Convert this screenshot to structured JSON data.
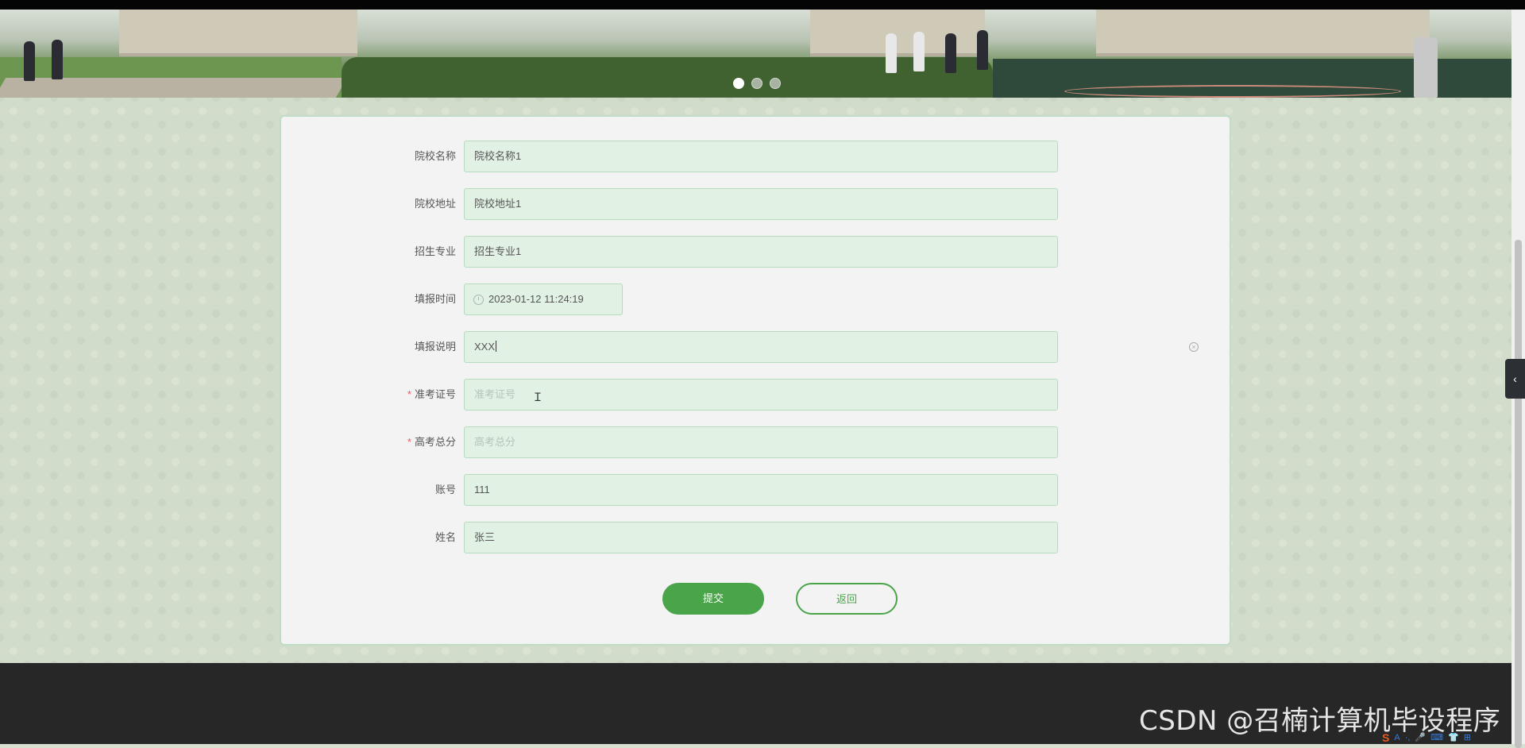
{
  "carousel": {
    "active_index": 0,
    "count": 3
  },
  "form": {
    "fields": [
      {
        "label": "院校名称",
        "value": "院校名称1",
        "required": false
      },
      {
        "label": "院校地址",
        "value": "院校地址1",
        "required": false
      },
      {
        "label": "招生专业",
        "value": "招生专业1",
        "required": false
      },
      {
        "label": "填报时间",
        "value": "2023-01-12 11:24:19",
        "required": false
      },
      {
        "label": "填报说明",
        "value": "XXX",
        "required": false
      },
      {
        "label": "准考证号",
        "placeholder": "准考证号",
        "required": true
      },
      {
        "label": "高考总分",
        "placeholder": "高考总分",
        "required": true
      },
      {
        "label": "账号",
        "value": "111",
        "required": false
      },
      {
        "label": "姓名",
        "value": "张三",
        "required": false
      }
    ],
    "required_mark": "*",
    "submit_label": "提交",
    "back_label": "返回"
  },
  "watermark": "CSDN @召楠计算机毕设程序",
  "ime_bar": {
    "logo": "S",
    "items": [
      "A",
      "·,",
      "🎤",
      "⌨",
      "👕",
      "⊞"
    ]
  },
  "colors": {
    "accent": "#4aa44a",
    "input_bg": "#e1f1e4",
    "footer": "#272727"
  }
}
